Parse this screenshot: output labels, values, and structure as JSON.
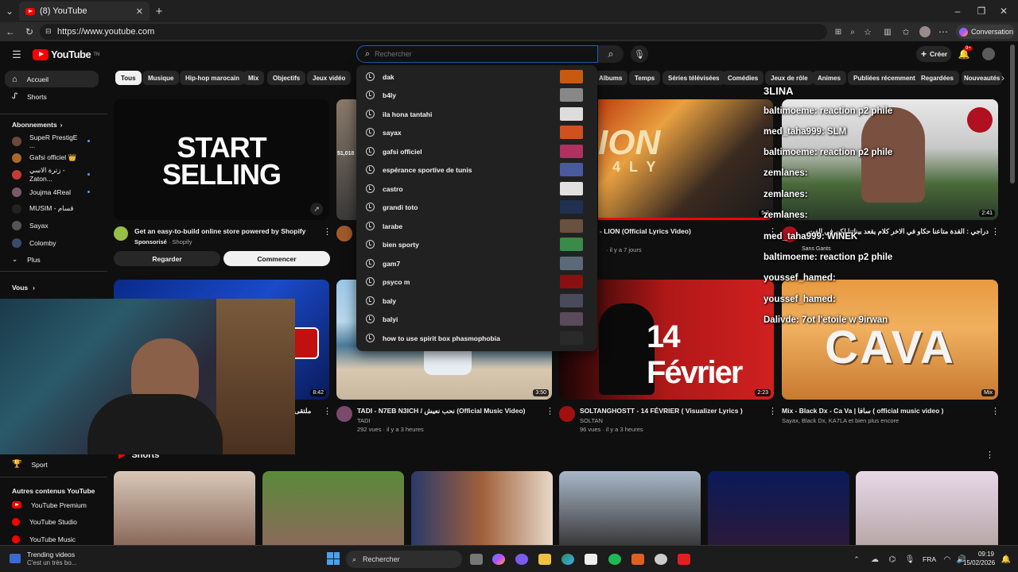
{
  "browser": {
    "tab_title": "(8) YouTube",
    "url": "https://www.youtube.com",
    "copilot_label": "Conversation"
  },
  "header": {
    "logo_text": "YouTube",
    "logo_sup": "TN",
    "search_placeholder": "Rechercher",
    "create_label": "Créer",
    "notif_count": "9+"
  },
  "sidebar": {
    "home": "Accueil",
    "shorts": "Shorts",
    "subs_title": "Abonnements",
    "subscriptions": [
      {
        "name": "SupeR PrestigE ...",
        "color": "#6a4a3a"
      },
      {
        "name": "Gafsi officiel 👑",
        "color": "#a86a2a"
      },
      {
        "name": "زترة الاسي - Zaton...",
        "color": "#c83a3a"
      },
      {
        "name": "Joujma 4Real",
        "color": "#7a5a6a"
      },
      {
        "name": "MUSIM - قسام",
        "color": "#222222"
      },
      {
        "name": "Sayax",
        "color": "#555555"
      },
      {
        "name": "Colomby",
        "color": "#3a4a6a"
      }
    ],
    "more": "Plus",
    "you": "Vous",
    "sport": "Sport",
    "other_title": "Autres contenus YouTube",
    "other_items": [
      "YouTube Premium",
      "YouTube Studio",
      "YouTube Music"
    ]
  },
  "chips": [
    "Tous",
    "Musique",
    "Hip-hop marocain",
    "Mix",
    "Objectifs",
    "Jeux vidéo",
    "Albums",
    "Temps",
    "Séries télévisées",
    "Comédies",
    "Jeux de rôle",
    "Animes",
    "Publiées récemment",
    "Regardées",
    "Nouveautés"
  ],
  "suggestions": [
    {
      "text": "dak",
      "color": "#c85a10"
    },
    {
      "text": "b4ly",
      "color": "#888888"
    },
    {
      "text": "ila hona tantahi",
      "color": "#dddddd"
    },
    {
      "text": "sayax",
      "color": "#d05020"
    },
    {
      "text": "gafsi officiel",
      "color": "#b03060"
    },
    {
      "text": "espérance sportive de tunis",
      "color": "#4a5aa0"
    },
    {
      "text": "castro",
      "color": "#e0e0e0"
    },
    {
      "text": "grandi toto",
      "color": "#203050"
    },
    {
      "text": "larabe",
      "color": "#6a5040"
    },
    {
      "text": "bien sporty",
      "color": "#3a8a4a"
    },
    {
      "text": "gam7",
      "color": "#5a6a7a"
    },
    {
      "text": "psyco m",
      "color": "#8a1010"
    },
    {
      "text": "baly",
      "color": "#4a4a5a"
    },
    {
      "text": "balyi",
      "color": "#5a4a5a"
    },
    {
      "text": "how to use spirit box phasmophobia",
      "color": "#2a2a2a"
    }
  ],
  "ad": {
    "thumb_line1": "START",
    "thumb_line2": "SELLING",
    "title": "Get an easy-to-build online store powered by Shopify",
    "sponsor_prefix": "Sponsorisé",
    "sponsor_name": "Shopify",
    "watch": "Regarder",
    "start": "Commencer"
  },
  "videos": {
    "v1_views": "51,018",
    "v3_thumb": "ION",
    "v3_thumb_sub": "4 L Y",
    "v3_duration": "5:3",
    "v3_title": "- LION (Official Lyrics Video)",
    "v3_meta": "· il y a 7 jours",
    "v4_duration": "2:41",
    "v4_title": "دراجي : القدة متاعنا حكاو في الاخر كلام يقعد بيناتنا لكن في الفت ... جسوفوي ايدي",
    "v5_duration": "8:42",
    "v5_title": "ملتقى",
    "v6_duration": "3:50",
    "v6_title": "TADI - N7EB N3ICH / نحب نعيش (Official Music Video)",
    "v6_channel": "TADI",
    "v6_meta": "292 vues · il y a 3 heures",
    "v7_thumb": "14 Février",
    "v7_duration": "2:23",
    "v7_title": "SOLTANGHOSTT - 14 FÉVRIER ( Visualizer Lyrics )",
    "v7_channel": "SOLTAN",
    "v7_meta": "96 vues · il y a 3 heures",
    "v8_thumb": "CAVA",
    "v8_duration": "Mix",
    "v8_title": "Mix - Black Dx - Ca Va | سافا ( official music video )",
    "v8_meta": "Sayax, Black Dx, KA7LA et bien plus encore"
  },
  "shorts_title": "Shorts",
  "chat": {
    "title": "3LINA",
    "lines": [
      "baltimoeme: reaction p2 phile",
      "med_taha999: SLM",
      "baltimoeme: reaction p2 phile",
      "zemlanes:",
      "zemlanes:",
      "zemlanes:",
      "med_taha999: WINEK",
      "Sans Gants",
      "baltimoeme: reaction p2 phile",
      "youssef_hamed:",
      "youssef_hamed:",
      "Dalivde: 7ot l'etoile w 9irwan"
    ]
  },
  "taskbar": {
    "trending_title": "Trending videos",
    "trending_sub": "C'est un très bo...",
    "search_label": "Rechercher",
    "lang": "FRA",
    "time": "09:19",
    "date": "15/02/2026"
  }
}
